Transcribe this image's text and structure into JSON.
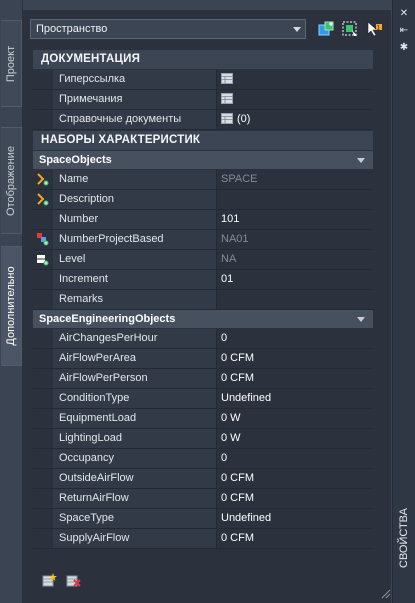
{
  "left_tabs": [
    {
      "label": "Проект",
      "active": false
    },
    {
      "label": "Отображение",
      "active": false
    },
    {
      "label": "Дополнительно",
      "active": true
    }
  ],
  "right_strip": {
    "title": "СВОЙСТВА",
    "icons": [
      "close-icon",
      "auto-hide-icon",
      "settings-icon"
    ]
  },
  "selector": {
    "value": "Пространство"
  },
  "toolbar_icons": [
    "quick-select-icon",
    "select-objects-icon",
    "pickadd-icon"
  ],
  "doc_section": {
    "title": "ДОКУМЕНТАЦИЯ",
    "rows": [
      {
        "name": "Гиперссылка",
        "value": "",
        "icon": "table-icon"
      },
      {
        "name": "Примечания",
        "value": "",
        "icon": "table-icon"
      },
      {
        "name": "Справочные документы",
        "value": "(0)",
        "icon": "table-icon"
      }
    ]
  },
  "props_section": {
    "title": "НАБОРЫ ХАРАКТЕРИСТИК",
    "groups": [
      {
        "title": "SpaceObjects",
        "rows": [
          {
            "name": "Name",
            "value": "SPACE",
            "dim": true,
            "icon": "formula-icon"
          },
          {
            "name": "Description",
            "value": "",
            "dim": false,
            "icon": "formula-icon"
          },
          {
            "name": "Number",
            "value": "101",
            "dim": false,
            "icon": ""
          },
          {
            "name": "NumberProjectBased",
            "value": "NA01",
            "dim": true,
            "icon": "project-icon"
          },
          {
            "name": "Level",
            "value": "NA",
            "dim": true,
            "icon": "level-icon"
          },
          {
            "name": "Increment",
            "value": "01",
            "dim": false,
            "icon": ""
          },
          {
            "name": "Remarks",
            "value": "",
            "dim": false,
            "icon": ""
          }
        ]
      },
      {
        "title": "SpaceEngineeringObjects",
        "rows": [
          {
            "name": "AirChangesPerHour",
            "value": "0"
          },
          {
            "name": "AirFlowPerArea",
            "value": "0 CFM"
          },
          {
            "name": "AirFlowPerPerson",
            "value": "0 CFM"
          },
          {
            "name": "ConditionType",
            "value": "Undefined"
          },
          {
            "name": "EquipmentLoad",
            "value": "0 W"
          },
          {
            "name": "LightingLoad",
            "value": "0 W"
          },
          {
            "name": "Occupancy",
            "value": "0"
          },
          {
            "name": "OutsideAirFlow",
            "value": "0 CFM"
          },
          {
            "name": "ReturnAirFlow",
            "value": "0 CFM"
          },
          {
            "name": "SpaceType",
            "value": "Undefined"
          },
          {
            "name": "SupplyAirFlow",
            "value": "0 CFM"
          }
        ]
      }
    ]
  },
  "bottom_icons": [
    "add-property-set-icon",
    "remove-property-set-icon"
  ],
  "colors": {
    "accent": "#f5a623",
    "background": "#2b323d",
    "frame": "#3b4453"
  }
}
